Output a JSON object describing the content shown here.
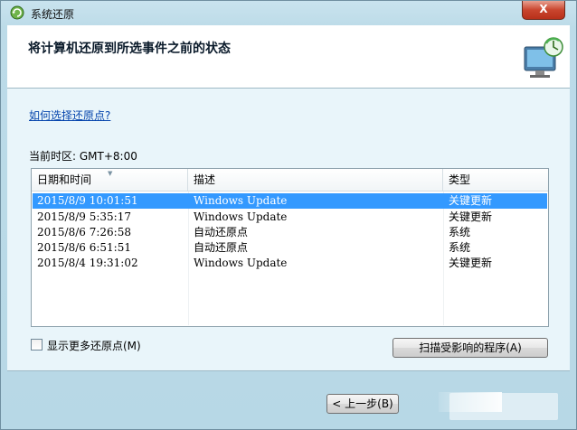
{
  "window": {
    "title": "系统还原",
    "close_label": "X"
  },
  "header": {
    "title": "将计算机还原到所选事件之前的状态"
  },
  "help_link": "如何选择还原点?",
  "timezone": "当前时区: GMT+8:00",
  "table": {
    "columns": [
      "日期和时间",
      "描述",
      "类型"
    ],
    "rows": [
      {
        "date": "2015/8/9 10:01:51",
        "description": "Windows Update",
        "type": "关键更新",
        "selected": true
      },
      {
        "date": "2015/8/9 5:35:17",
        "description": "Windows Update",
        "type": "关键更新"
      },
      {
        "date": "2015/8/6 7:26:58",
        "description": "自动还原点",
        "type": "系统"
      },
      {
        "date": "2015/8/6 6:51:51",
        "description": "自动还原点",
        "type": "系统"
      },
      {
        "date": "2015/8/4 19:31:02",
        "description": "Windows Update",
        "type": "关键更新"
      }
    ]
  },
  "show_more_checkbox": {
    "label": "显示更多还原点(M)",
    "checked": false
  },
  "scan_button": "扫描受影响的程序(A)",
  "back_button": "< 上一步(B)",
  "colors": {
    "selection": "#3399ff",
    "link": "#0645ad"
  }
}
